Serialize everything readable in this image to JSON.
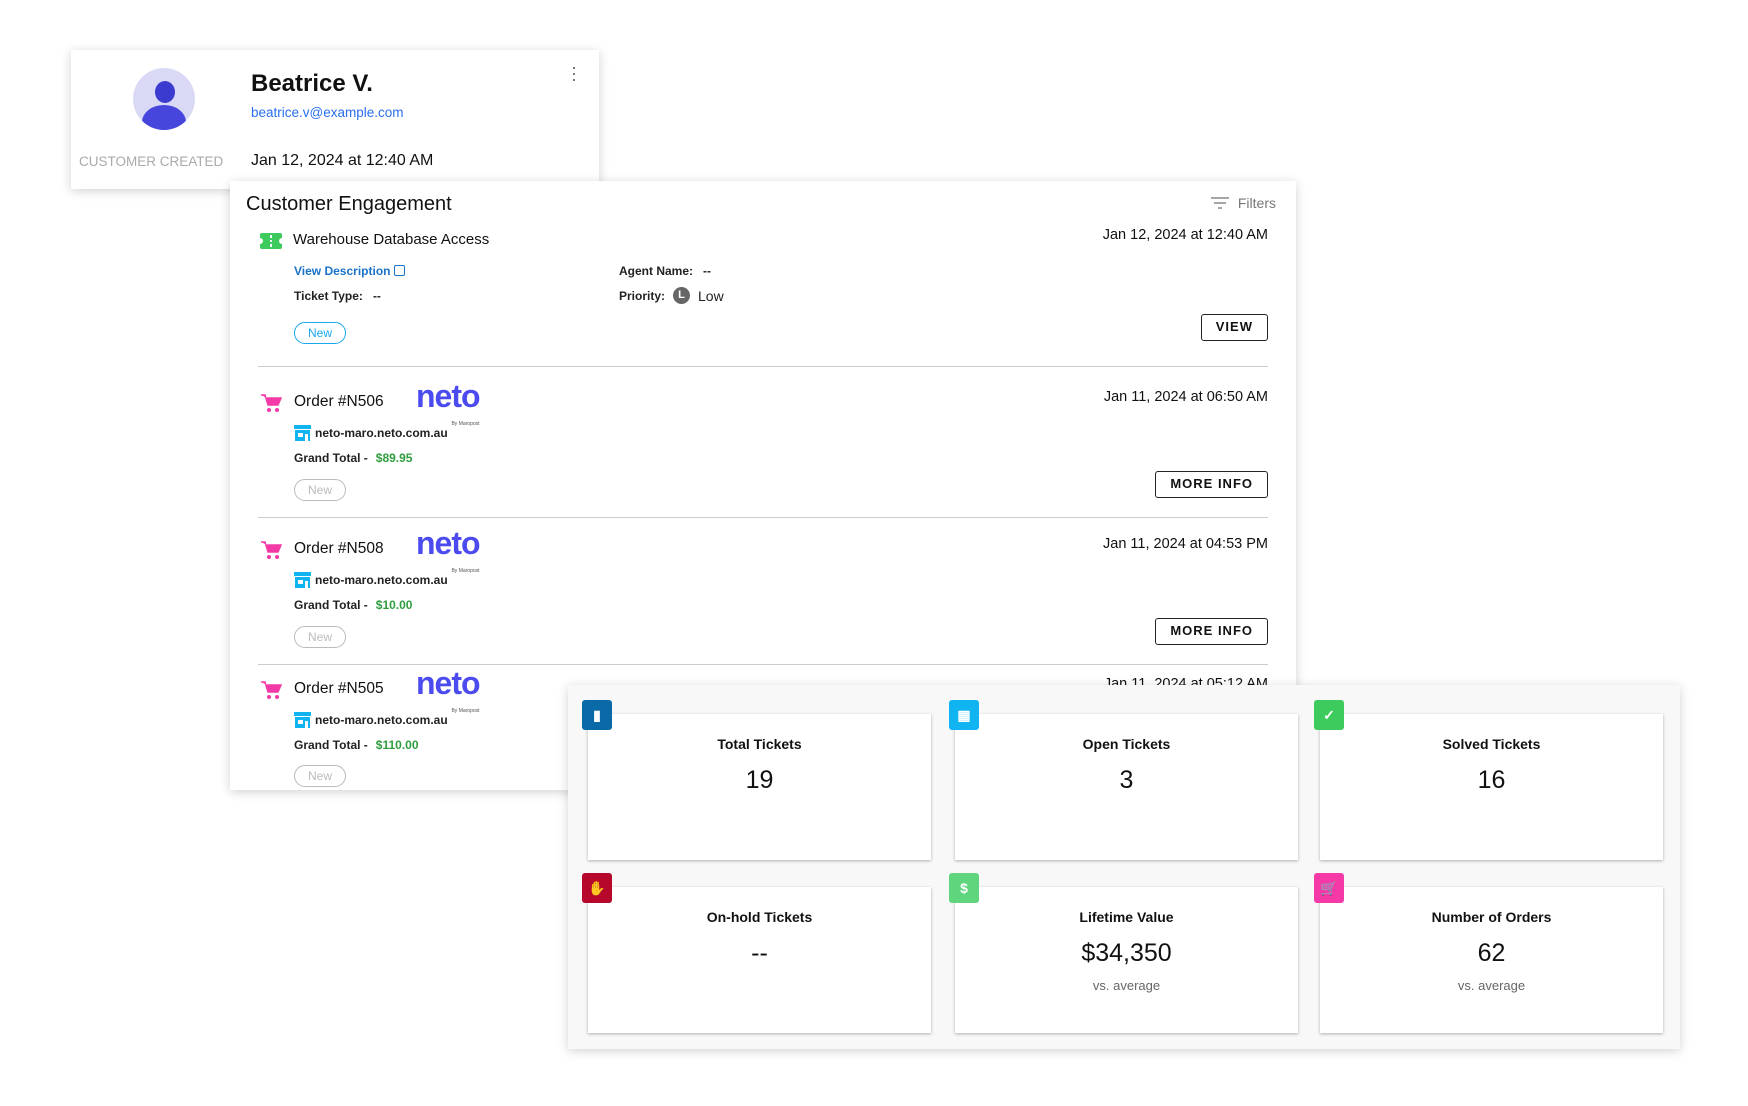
{
  "profile": {
    "name": "Beatrice V.",
    "email": "beatrice.v@example.com",
    "created_label": "CUSTOMER CREATED",
    "created_date": "Jan 12, 2024 at 12:40 AM",
    "menu_icon": "kebab-icon"
  },
  "engagement": {
    "title": "Customer Engagement",
    "filters_label": "Filters",
    "ticket": {
      "title": "Warehouse Database Access",
      "date": "Jan 12, 2024 at 12:40 AM",
      "view_description": "View Description",
      "agent_label": "Agent Name:",
      "agent_value": "--",
      "type_label": "Ticket Type:",
      "type_value": "--",
      "priority_label": "Priority:",
      "priority_badge": "L",
      "priority_value": "Low",
      "status": "New",
      "button": "VIEW"
    },
    "orders": [
      {
        "title": "Order #N506",
        "brand": "neto",
        "brand_sub": "By Maropost",
        "date": "Jan 11, 2024 at 06:50 AM",
        "store": "neto-maro.neto.com.au",
        "total_label": "Grand Total -",
        "total": "$89.95",
        "status": "New",
        "button": "MORE INFO"
      },
      {
        "title": "Order #N508",
        "brand": "neto",
        "brand_sub": "By Maropost",
        "date": "Jan 11, 2024 at 04:53 PM",
        "store": "neto-maro.neto.com.au",
        "total_label": "Grand Total -",
        "total": "$10.00",
        "status": "New",
        "button": "MORE INFO"
      },
      {
        "title": "Order #N505",
        "brand": "neto",
        "brand_sub": "By Maropost",
        "date": "Jan 11, 2024 at 05:12 AM",
        "store": "neto-maro.neto.com.au",
        "total_label": "Grand Total -",
        "total": "$110.00",
        "status": "New"
      }
    ]
  },
  "stats": [
    {
      "label": "Total Tickets",
      "value": "19",
      "icon": "tickets-icon",
      "color": "#0a6aa8"
    },
    {
      "label": "Open Tickets",
      "value": "3",
      "icon": "ticket-icon",
      "color": "#0fb4f0"
    },
    {
      "label": "Solved Tickets",
      "value": "16",
      "icon": "shield-check-icon",
      "color": "#3ccb5c"
    },
    {
      "label": "On-hold Tickets",
      "value": "--",
      "icon": "hand-icon",
      "color": "#b5082a"
    },
    {
      "label": "Lifetime Value",
      "value": "$34,350",
      "sub": "vs. average",
      "icon": "dollar-icon",
      "color": "#5fd67e"
    },
    {
      "label": "Number of Orders",
      "value": "62",
      "sub": "vs. average",
      "icon": "cart-icon",
      "color": "#f53aa8"
    }
  ]
}
